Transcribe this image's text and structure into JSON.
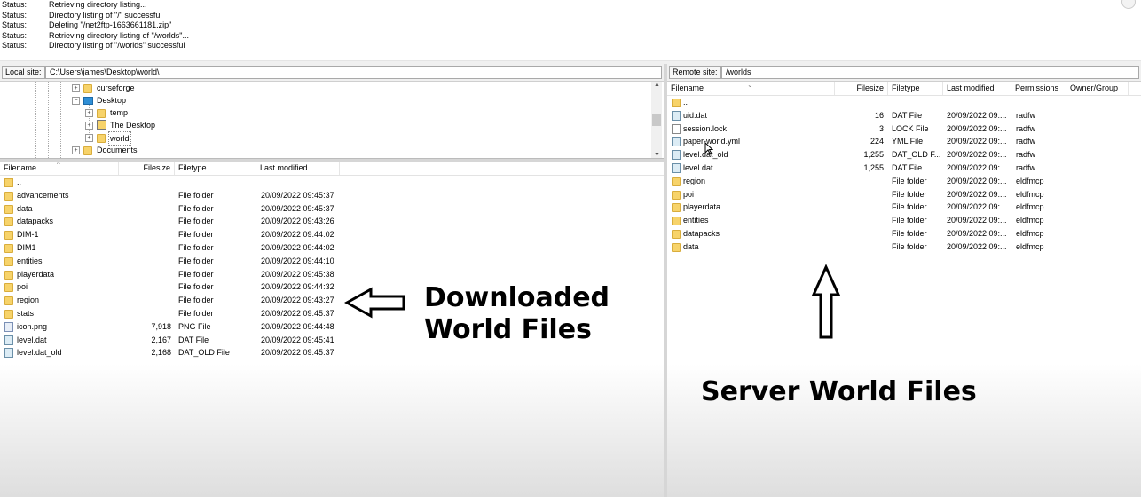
{
  "log": [
    {
      "key": "Status:",
      "value": "Retrieving directory listing..."
    },
    {
      "key": "Status:",
      "value": "Directory listing of \"/\" successful"
    },
    {
      "key": "Status:",
      "value": "Deleting \"/net2ftp-1663661181.zip\""
    },
    {
      "key": "Status:",
      "value": "Retrieving directory listing of \"/worlds\"..."
    },
    {
      "key": "Status:",
      "value": "Directory listing of \"/worlds\" successful"
    }
  ],
  "local": {
    "site_label": "Local site:",
    "path": "C:\\Users\\james\\Desktop\\world\\",
    "tree": [
      {
        "label": "curseforge",
        "expander": "+",
        "icon": "folder"
      },
      {
        "label": "Desktop",
        "expander": "−",
        "icon": "desktop"
      },
      {
        "label": "temp",
        "expander": "+",
        "icon": "folder"
      },
      {
        "label": "The Desktop",
        "expander": "+",
        "icon": "user-folder"
      },
      {
        "label": "world",
        "expander": "+",
        "icon": "folder"
      },
      {
        "label": "Documents",
        "expander": "+",
        "icon": "folder"
      }
    ],
    "columns": {
      "filename": "Filename",
      "filesize": "Filesize",
      "filetype": "Filetype",
      "modified": "Last modified"
    },
    "files": [
      {
        "name": "..",
        "size": "",
        "type": "",
        "modified": "",
        "icon": "folder-up"
      },
      {
        "name": "advancements",
        "size": "",
        "type": "File folder",
        "modified": "20/09/2022 09:45:37",
        "icon": "folder"
      },
      {
        "name": "data",
        "size": "",
        "type": "File folder",
        "modified": "20/09/2022 09:45:37",
        "icon": "folder"
      },
      {
        "name": "datapacks",
        "size": "",
        "type": "File folder",
        "modified": "20/09/2022 09:43:26",
        "icon": "folder"
      },
      {
        "name": "DIM-1",
        "size": "",
        "type": "File folder",
        "modified": "20/09/2022 09:44:02",
        "icon": "folder"
      },
      {
        "name": "DIM1",
        "size": "",
        "type": "File folder",
        "modified": "20/09/2022 09:44:02",
        "icon": "folder"
      },
      {
        "name": "entities",
        "size": "",
        "type": "File folder",
        "modified": "20/09/2022 09:44:10",
        "icon": "folder"
      },
      {
        "name": "playerdata",
        "size": "",
        "type": "File folder",
        "modified": "20/09/2022 09:45:38",
        "icon": "folder"
      },
      {
        "name": "poi",
        "size": "",
        "type": "File folder",
        "modified": "20/09/2022 09:44:32",
        "icon": "folder"
      },
      {
        "name": "region",
        "size": "",
        "type": "File folder",
        "modified": "20/09/2022 09:43:27",
        "icon": "folder"
      },
      {
        "name": "stats",
        "size": "",
        "type": "File folder",
        "modified": "20/09/2022 09:45:37",
        "icon": "folder"
      },
      {
        "name": "icon.png",
        "size": "7,918",
        "type": "PNG File",
        "modified": "20/09/2022 09:44:48",
        "icon": "image"
      },
      {
        "name": "level.dat",
        "size": "2,167",
        "type": "DAT File",
        "modified": "20/09/2022 09:45:41",
        "icon": "dat"
      },
      {
        "name": "level.dat_old",
        "size": "2,168",
        "type": "DAT_OLD File",
        "modified": "20/09/2022 09:45:37",
        "icon": "dat"
      }
    ]
  },
  "remote": {
    "site_label": "Remote site:",
    "path": "/worlds",
    "columns": {
      "filename": "Filename",
      "filesize": "Filesize",
      "filetype": "Filetype",
      "modified": "Last modified",
      "permissions": "Permissions",
      "owner": "Owner/Group"
    },
    "files": [
      {
        "name": "..",
        "size": "",
        "type": "",
        "modified": "",
        "perm": "",
        "icon": "folder-up"
      },
      {
        "name": "uid.dat",
        "size": "16",
        "type": "DAT File",
        "modified": "20/09/2022 09:...",
        "perm": "radfw",
        "icon": "dat"
      },
      {
        "name": "session.lock",
        "size": "3",
        "type": "LOCK File",
        "modified": "20/09/2022 09:...",
        "perm": "radfw",
        "icon": "file"
      },
      {
        "name": "paper-world.yml",
        "size": "224",
        "type": "YML File",
        "modified": "20/09/2022 09:...",
        "perm": "radfw",
        "icon": "dat"
      },
      {
        "name": "level.dat_old",
        "size": "1,255",
        "type": "DAT_OLD F...",
        "modified": "20/09/2022 09:...",
        "perm": "radfw",
        "icon": "dat"
      },
      {
        "name": "level.dat",
        "size": "1,255",
        "type": "DAT File",
        "modified": "20/09/2022 09:...",
        "perm": "radfw",
        "icon": "dat"
      },
      {
        "name": "region",
        "size": "",
        "type": "File folder",
        "modified": "20/09/2022 09:...",
        "perm": "eldfmcp",
        "icon": "folder"
      },
      {
        "name": "poi",
        "size": "",
        "type": "File folder",
        "modified": "20/09/2022 09:...",
        "perm": "eldfmcp",
        "icon": "folder"
      },
      {
        "name": "playerdata",
        "size": "",
        "type": "File folder",
        "modified": "20/09/2022 09:...",
        "perm": "eldfmcp",
        "icon": "folder"
      },
      {
        "name": "entities",
        "size": "",
        "type": "File folder",
        "modified": "20/09/2022 09:...",
        "perm": "eldfmcp",
        "icon": "folder"
      },
      {
        "name": "datapacks",
        "size": "",
        "type": "File folder",
        "modified": "20/09/2022 09:...",
        "perm": "eldfmcp",
        "icon": "folder"
      },
      {
        "name": "data",
        "size": "",
        "type": "File folder",
        "modified": "20/09/2022 09:...",
        "perm": "eldfmcp",
        "icon": "folder"
      }
    ]
  },
  "annotations": {
    "downloaded_line1": "Downloaded",
    "downloaded_line2": "World Files",
    "server": "Server World Files"
  }
}
